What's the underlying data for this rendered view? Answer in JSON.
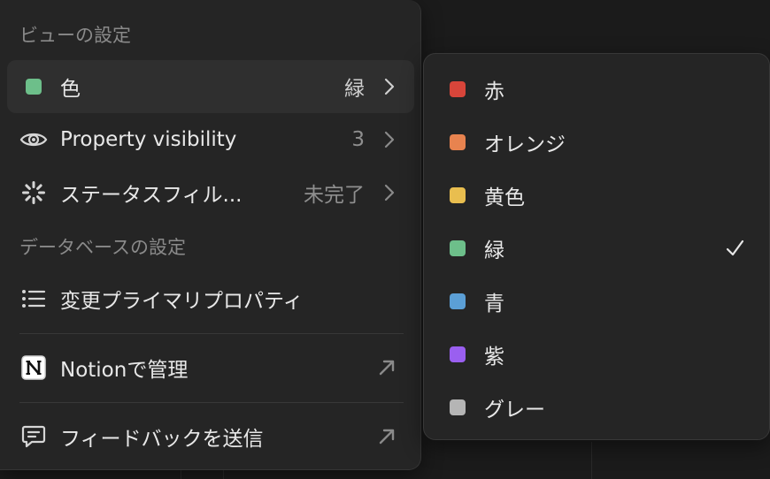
{
  "view_settings": {
    "title": "ビューの設定",
    "items": [
      {
        "label": "色",
        "value": "緑",
        "icon": "green-swatch",
        "swatch_color": "#6dbf8a"
      },
      {
        "label": "Property visibility",
        "value": "3",
        "icon": "eye-icon"
      },
      {
        "label": "ステータスフィル...",
        "value": "未完了",
        "icon": "loading-spinner-icon"
      }
    ]
  },
  "database_settings": {
    "title": "データベースの設定",
    "items": [
      {
        "label": "変更プライマリプロパティ",
        "icon": "list-icon"
      }
    ]
  },
  "notion_manage": {
    "label": "Notionで管理",
    "icon": "notion-logo-icon"
  },
  "feedback": {
    "label": "フィードバックを送信",
    "icon": "chat-bubble-icon"
  },
  "color_submenu": {
    "selected": "緑",
    "options": [
      {
        "label": "赤",
        "color": "#d8453a"
      },
      {
        "label": "オレンジ",
        "color": "#e8834f"
      },
      {
        "label": "黄色",
        "color": "#e9be4f"
      },
      {
        "label": "緑",
        "color": "#6dbf8a"
      },
      {
        "label": "青",
        "color": "#5b9fd6"
      },
      {
        "label": "紫",
        "color": "#9a5ff0"
      },
      {
        "label": "グレー",
        "color": "#b5b5b5"
      }
    ]
  },
  "colors": {
    "menu_bg": "#252525",
    "active_row_bg": "#2f2f2f",
    "text": "#e8e8e8",
    "muted_text": "#8f8f8f"
  }
}
